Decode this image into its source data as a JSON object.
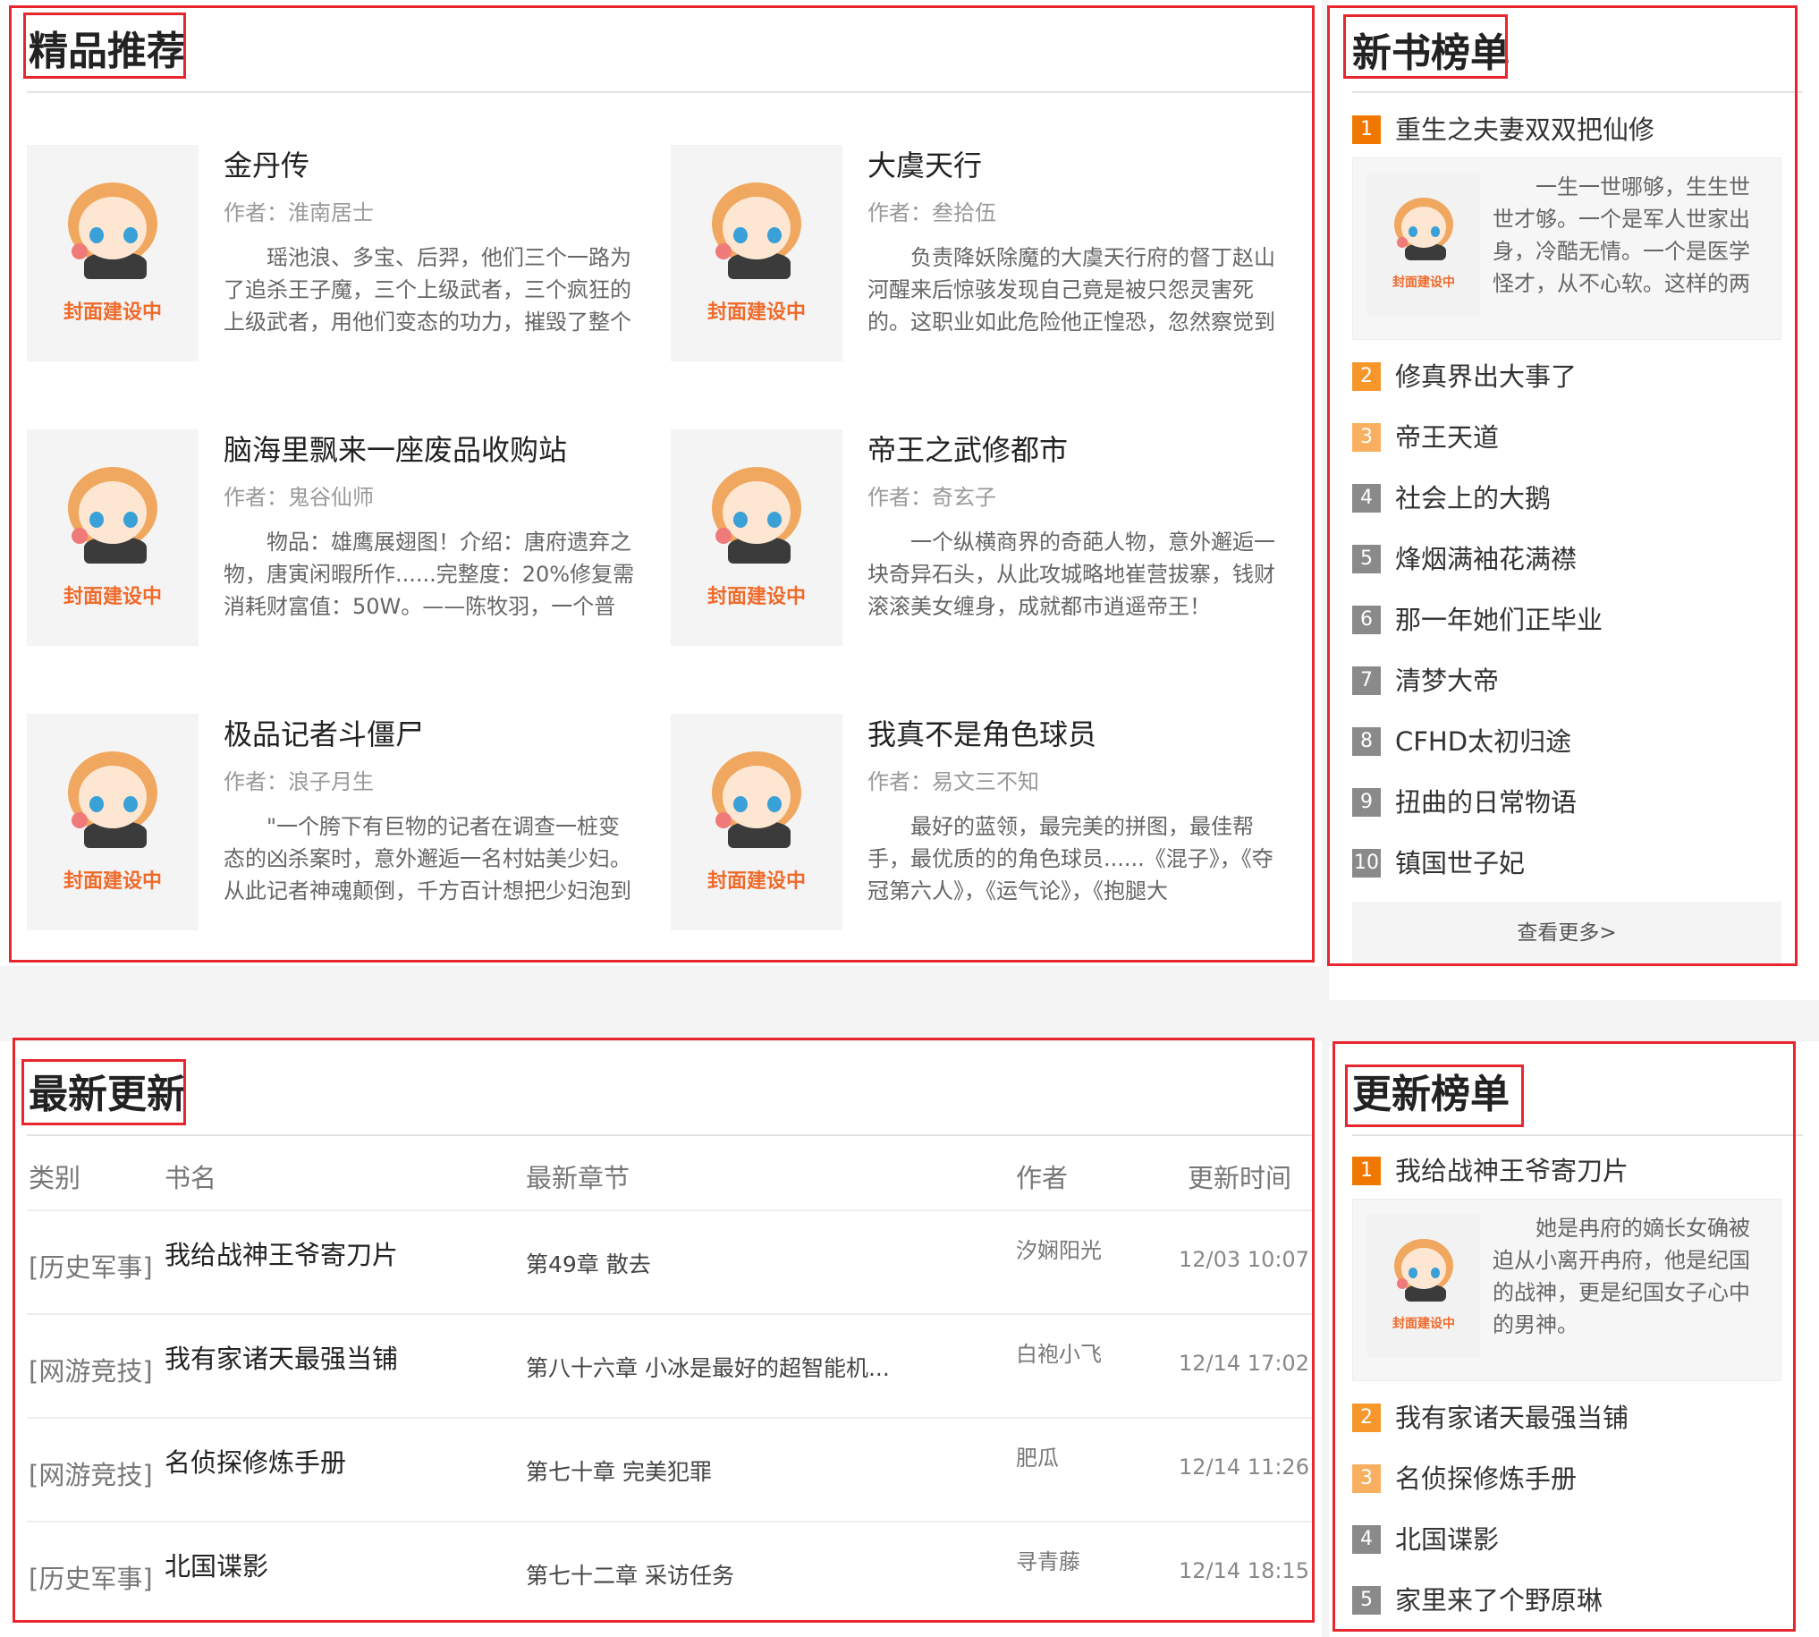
{
  "featured": {
    "title": "精品推荐",
    "books": [
      {
        "title": "金丹传",
        "author": "作者：淮南居士",
        "intro": "瑶池浪、多宝、后羿，他们三个一路为了追杀王子魔，三个上级武者，三个疯狂的上级武者，用他们变态的功力，摧毁了整个"
      },
      {
        "title": "大虞天行",
        "author": "作者：叁拾伍",
        "intro": "负责降妖除魔的大虞天行府的督丁赵山河醒来后惊骇发现自己竟是被只怨灵害死的。这职业如此危险他正惶恐，忽然察觉到"
      },
      {
        "title": "脑海里飘来一座废品收购站",
        "author": "作者：鬼谷仙师",
        "intro": "物品：雄鹰展翅图！介绍：唐府遗弃之物，唐寅闲暇所作......完整度：20%修复需消耗财富值：50W。——陈牧羽，一个普"
      },
      {
        "title": "帝王之武修都市",
        "author": "作者：奇玄子",
        "intro": "一个纵横商界的奇葩人物，意外邂逅一块奇异石头，从此攻城略地崔营拔寨，钱财滚滚美女缠身，成就都市逍遥帝王！"
      },
      {
        "title": "极品记者斗僵尸",
        "author": "作者：浪子月生",
        "intro": "\"一个胯下有巨物的记者在调查一桩变态的凶杀案时，意外邂逅一名村姑美少妇。从此记者神魂颠倒，千方百计想把少妇泡到"
      },
      {
        "title": "我真不是角色球员",
        "author": "作者：易文三不知",
        "intro": "最好的蓝领，最完美的拼图，最佳帮手，最优质的的角色球员......《混子》，《夺冠第六人》，《运气论》，《抱腿大"
      }
    ],
    "cover_label": "封面建设中"
  },
  "new_rank": {
    "title": "新书榜单",
    "items": [
      "重生之夫妻双双把仙修",
      "修真界出大事了",
      "帝王天道",
      "社会上的大鹅",
      "烽烟满袖花满襟",
      "那一年她们正毕业",
      "清梦大帝",
      "CFHD太初归途",
      "扭曲的日常物语",
      "镇国世子妃"
    ],
    "top_intro": "一生一世哪够，生生世世才够。一个是军人世家出身，冷酷无情。一个是医学怪才，从不心软。这样的两",
    "more": "查看更多>"
  },
  "latest": {
    "title": "最新更新",
    "headers": {
      "category": "类别",
      "name": "书名",
      "chapter": "最新章节",
      "author": "作者",
      "time": "更新时间"
    },
    "rows": [
      {
        "category": "[历史军事]",
        "name": "我给战神王爷寄刀片",
        "chapter": "第49章 散去",
        "author": "汐娴阳光",
        "time": "12/03 10:07"
      },
      {
        "category": "[网游竞技]",
        "name": "我有家诸天最强当铺",
        "chapter": "第八十六章 小冰是最好的超智能机...",
        "author": "白袍小飞",
        "time": "12/14 17:02"
      },
      {
        "category": "[网游竞技]",
        "name": "名侦探修炼手册",
        "chapter": "第七十章 完美犯罪",
        "author": "肥瓜",
        "time": "12/14 11:26"
      },
      {
        "category": "[历史军事]",
        "name": "北国谍影",
        "chapter": "第七十二章 采访任务",
        "author": "寻青藤",
        "time": "12/14 18:15"
      }
    ]
  },
  "update_rank": {
    "title": "更新榜单",
    "items": [
      "我给战神王爷寄刀片",
      "我有家诸天最强当铺",
      "名侦探修炼手册",
      "北国谍影",
      "家里来了个野原琳"
    ],
    "top_intro": "她是冉府的嫡长女确被迫从小离开冉府，他是纪国的战神，更是纪国女子心中的男神。"
  },
  "rank_colors": [
    "#f07800",
    "#f7962b",
    "#f8b060",
    "#8a8a8a",
    "#8a8a8a",
    "#8a8a8a",
    "#8a8a8a",
    "#8a8a8a",
    "#8a8a8a",
    "#8a8a8a"
  ],
  "accent_red": "#e8262d"
}
